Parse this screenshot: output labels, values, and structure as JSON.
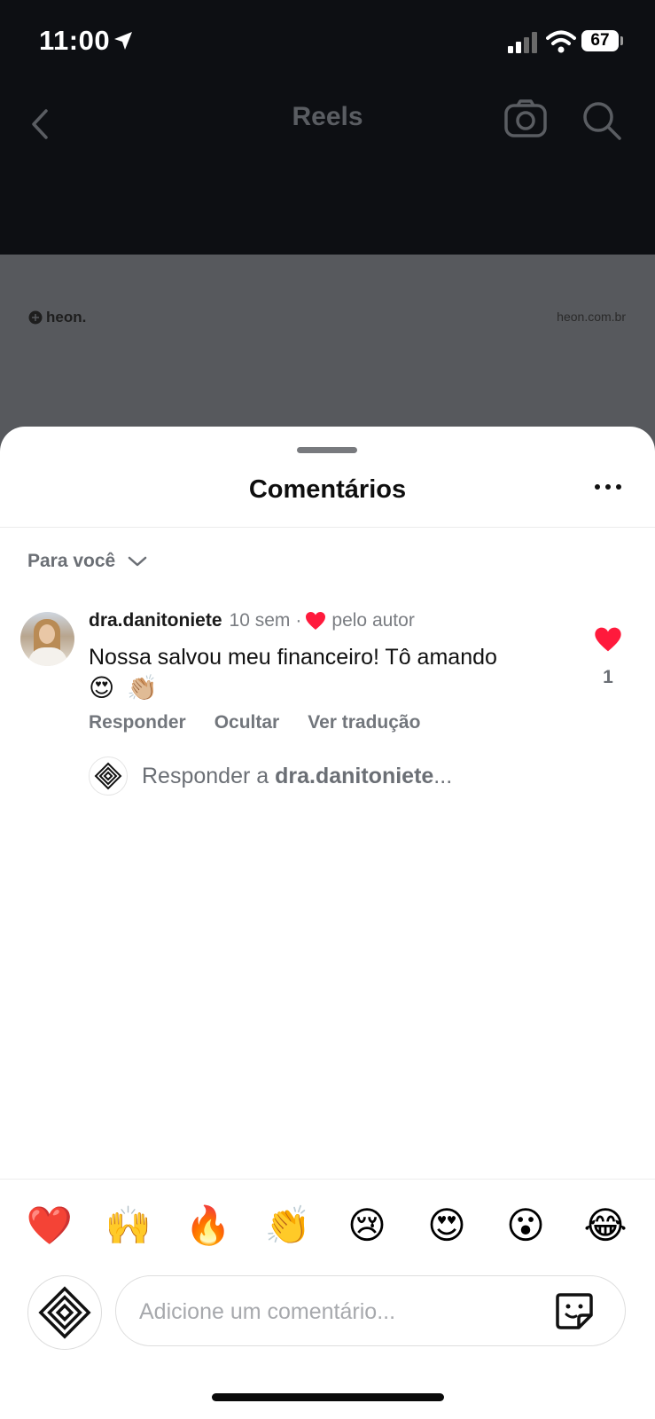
{
  "status_bar": {
    "time": "11:00",
    "battery": "67"
  },
  "nav": {
    "title": "Reels"
  },
  "video": {
    "brand": "heon.",
    "url": "heon.com.br"
  },
  "sheet": {
    "title": "Comentários",
    "filter_label": "Para você",
    "comment": {
      "user": "dra.danitoniete",
      "time": "10 sem",
      "separator": "·",
      "liked_by_author": "pelo autor",
      "text": "Nossa salvou meu financeiro! Tô amando",
      "emojis": [
        "😍",
        "👏🏼"
      ],
      "like_count": "1",
      "actions": [
        "Responder",
        "Ocultar",
        "Ver tradução"
      ]
    },
    "reply": {
      "prefix": "Responder a ",
      "user": "dra.danitoniete",
      "suffix": "..."
    }
  },
  "emoji_bar": [
    "❤️",
    "🙌",
    "🔥",
    "👏",
    "😢",
    "😍",
    "😮",
    "😂"
  ],
  "composer": {
    "placeholder": "Adicione um comentário..."
  }
}
